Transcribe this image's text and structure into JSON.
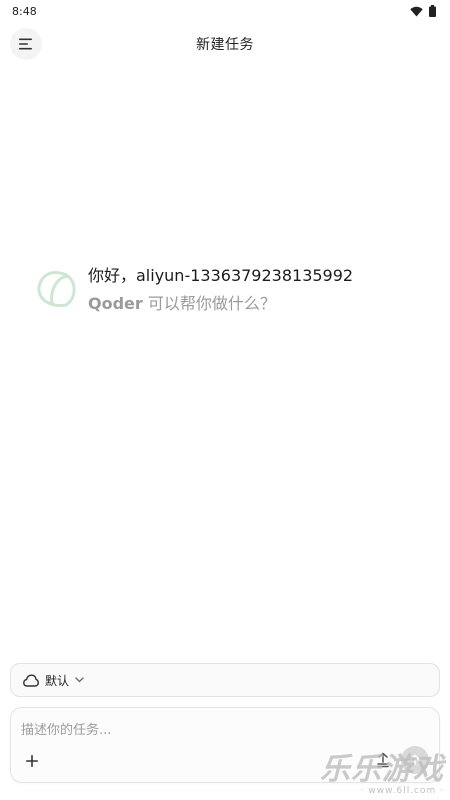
{
  "status_bar": {
    "time": "8:48",
    "wifi_icon": "wifi-icon",
    "battery_icon": "battery-icon"
  },
  "header": {
    "title": "新建任务",
    "menu_icon": "menu-icon"
  },
  "greeting": {
    "line1": "你好，aliyun-1336379238135992",
    "brand": "Qoder",
    "line2_rest": " 可以帮你做什么？",
    "logo_icon": "qoder-logo-icon"
  },
  "model_selector": {
    "label": "默认",
    "cloud_icon": "cloud-icon",
    "chevron_icon": "chevron-down-icon"
  },
  "task_input": {
    "placeholder": "描述你的任务...",
    "value": "",
    "add_icon": "plus-icon",
    "attach_icon": "attach-icon",
    "send_icon": "send-icon"
  },
  "watermark": {
    "main": "乐乐游戏",
    "sub": "· www.6ll.com ·"
  },
  "colors": {
    "background": "#ffffff",
    "muted_text": "#9a9a9a",
    "border": "#e2e2e2",
    "logo_green": "#cfe6d4"
  }
}
